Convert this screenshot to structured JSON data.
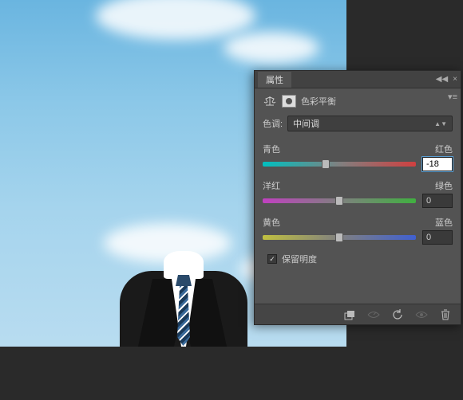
{
  "panel": {
    "tab_label": "属性",
    "title": "色彩平衡",
    "tone_label": "色调:",
    "tone_value": "中间调",
    "preserve_luminosity": "保留明度",
    "preserve_checked": true
  },
  "sliders": [
    {
      "left_label": "青色",
      "right_label": "红色",
      "value": "-18",
      "gradient": "grad-cyan-red",
      "pos": 41,
      "focused": true
    },
    {
      "left_label": "洋红",
      "right_label": "绿色",
      "value": "0",
      "gradient": "grad-mag-green",
      "pos": 50,
      "focused": false
    },
    {
      "left_label": "黄色",
      "right_label": "蓝色",
      "value": "0",
      "gradient": "grad-yel-blue",
      "pos": 50,
      "focused": false
    }
  ],
  "footer_icons": {
    "clip": "clip-to-layer-icon",
    "view_prev": "view-previous-icon",
    "reset": "reset-icon",
    "visibility": "visibility-icon",
    "delete": "trash-icon"
  }
}
